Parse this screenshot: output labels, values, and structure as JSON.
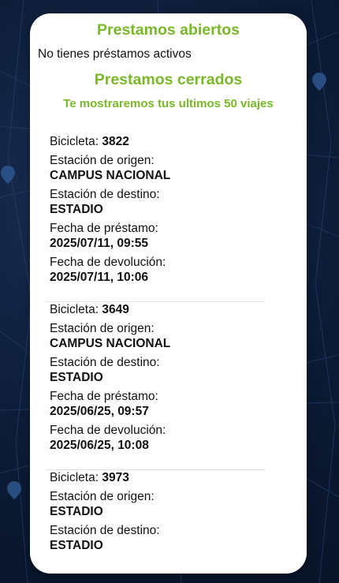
{
  "open_loans": {
    "title": "Prestamos abiertos",
    "empty_message": "No tienes préstamos activos"
  },
  "closed_loans": {
    "title": "Prestamos cerrados",
    "subtitle": "Te mostraremos tus ultimos 50 viajes",
    "labels": {
      "bike": "Bicicleta:",
      "origin": "Estación de origen:",
      "destination": "Estación de destino:",
      "loan_date": "Fecha de préstamo:",
      "return_date": "Fecha de devolución:"
    },
    "trips": [
      {
        "bike": "3822",
        "origin": "CAMPUS NACIONAL",
        "destination": "ESTADIO",
        "loan_date": "2025/07/11, 09:55",
        "return_date": "2025/07/11, 10:06"
      },
      {
        "bike": "3649",
        "origin": "CAMPUS NACIONAL",
        "destination": "ESTADIO",
        "loan_date": "2025/06/25, 09:57",
        "return_date": "2025/06/25, 10:08"
      },
      {
        "bike": "3973",
        "origin": "ESTADIO",
        "destination": "ESTADIO"
      }
    ]
  },
  "theme": {
    "accent": "#7ab82a",
    "background": "#0c1b36",
    "card": "#ffffff"
  }
}
